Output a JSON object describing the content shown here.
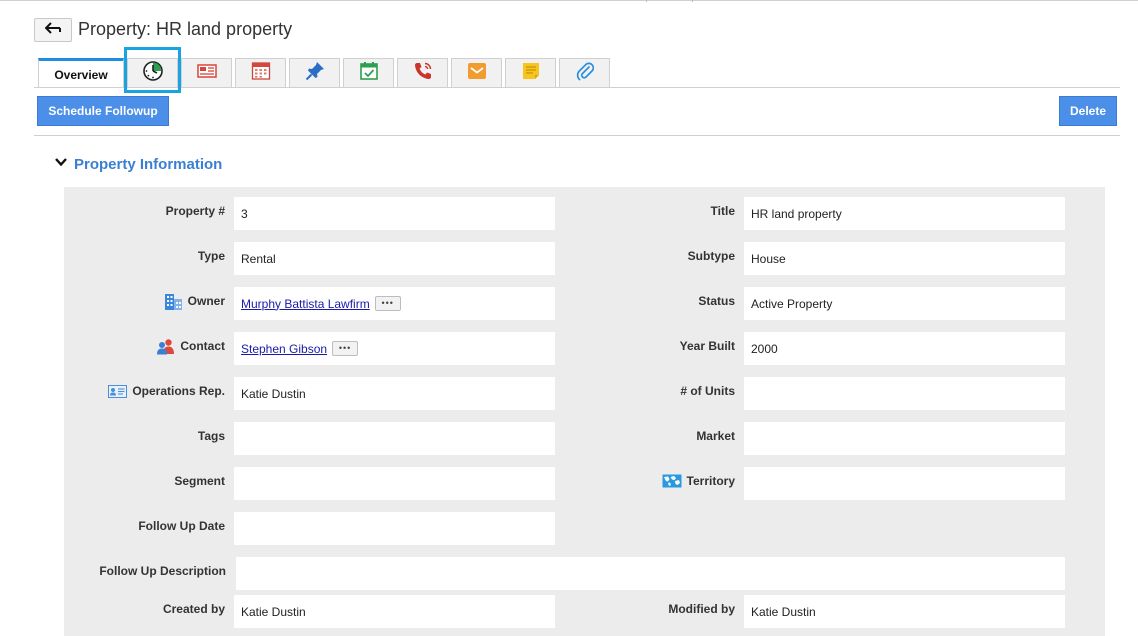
{
  "header": {
    "title": "Property: HR land property"
  },
  "tabs": [
    {
      "label": "Overview",
      "active": true
    },
    {
      "icon": "timeline-clock-icon"
    },
    {
      "icon": "newspaper-icon"
    },
    {
      "icon": "calendar-icon"
    },
    {
      "icon": "pushpin-icon"
    },
    {
      "icon": "task-check-icon"
    },
    {
      "icon": "phone-call-icon"
    },
    {
      "icon": "email-envelope-icon"
    },
    {
      "icon": "sticky-note-icon"
    },
    {
      "icon": "paperclip-icon"
    }
  ],
  "toolbar": {
    "schedule_label": "Schedule Followup",
    "delete_label": "Delete"
  },
  "section": {
    "title": "Property Information"
  },
  "fields": {
    "property_no": {
      "label": "Property #",
      "value": "3"
    },
    "title": {
      "label": "Title",
      "value": "HR land property"
    },
    "type": {
      "label": "Type",
      "value": "Rental"
    },
    "subtype": {
      "label": "Subtype",
      "value": "House"
    },
    "owner": {
      "label": "Owner",
      "value": "Murphy Battista Lawfirm"
    },
    "status": {
      "label": "Status",
      "value": "Active Property"
    },
    "contact": {
      "label": "Contact",
      "value": "Stephen Gibson"
    },
    "year_built": {
      "label": "Year Built",
      "value": "2000"
    },
    "operations_rep": {
      "label": "Operations Rep.",
      "value": "Katie Dustin"
    },
    "units": {
      "label": "# of Units",
      "value": ""
    },
    "tags": {
      "label": "Tags",
      "value": ""
    },
    "market": {
      "label": "Market",
      "value": ""
    },
    "segment": {
      "label": "Segment",
      "value": ""
    },
    "territory": {
      "label": "Territory",
      "value": ""
    },
    "follow_up_date": {
      "label": "Follow Up Date",
      "value": ""
    },
    "follow_up_description": {
      "label": "Follow Up Description",
      "value": ""
    },
    "created_by": {
      "label": "Created by",
      "value": "Katie Dustin"
    },
    "modified_by": {
      "label": "Modified by",
      "value": "Katie Dustin"
    }
  },
  "colors": {
    "accent": "#4b8fe8",
    "section_title": "#3a7fd4",
    "highlight": "#19a3e0",
    "link": "#1a1aa8"
  }
}
